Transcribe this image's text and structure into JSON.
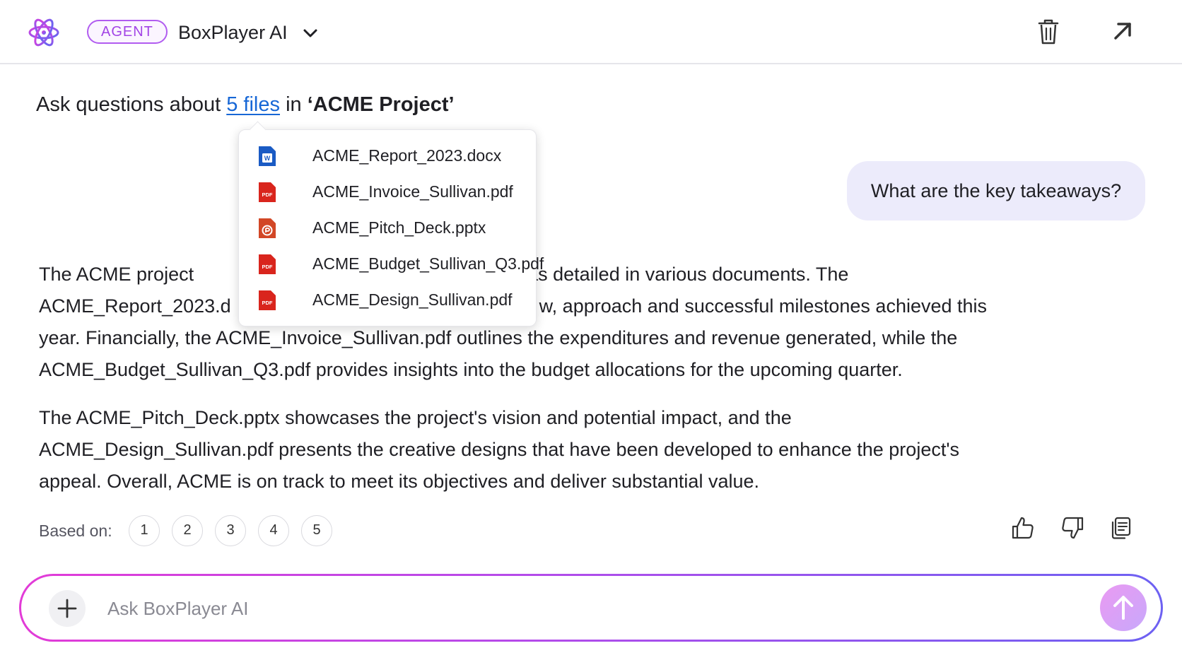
{
  "header": {
    "badge": "AGENT",
    "app_name": "BoxPlayer AI",
    "icons": {
      "logo": "atom-logo-icon",
      "dropdown": "chevron-down-icon",
      "delete": "trash-icon",
      "expand": "arrow-up-right-icon"
    }
  },
  "intro": {
    "prefix": "Ask questions about",
    "files_link": "5 files",
    "middle": "in",
    "project": "‘ACME Project’"
  },
  "files_popup": {
    "items": [
      {
        "name": "ACME_Report_2023.docx",
        "icon": "word-doc-icon"
      },
      {
        "name": "ACME_Invoice_Sullivan.pdf",
        "icon": "pdf-icon"
      },
      {
        "name": "ACME_Pitch_Deck.pptx",
        "icon": "powerpoint-icon"
      },
      {
        "name": "ACME_Budget_Sullivan_Q3.pdf",
        "icon": "pdf-icon"
      },
      {
        "name": "ACME_Design_Sullivan.pdf",
        "icon": "pdf-icon"
      }
    ],
    "pdf_badge": "PDF"
  },
  "user_message": "What are the key takeaways?",
  "answer": {
    "paragraph1_visible": "The ACME project ███████████████████████████3, as detailed in various documents. The ACME_Report_2023.d█████████████████████████████w, approach and successful milestones achieved this year. Financially, the ACME_Invoice_Sullivan.pdf outlines the expenditures and revenue generated, while the ACME_Budget_Sullivan_Q3.pdf provides insights into the budget allocations for the upcoming quarter.",
    "paragraph1_line1_start": "The ACME project",
    "paragraph1_line1_end": "3, as detailed in various documents. The",
    "paragraph1_line2_start": "ACME_Report_2023.d",
    "paragraph1_line2_end": "w, approach and successful milestones achieved this",
    "paragraph1_rest": "year. Financially, the ACME_Invoice_Sullivan.pdf outlines the expenditures and revenue generated, while the ACME_Budget_Sullivan_Q3.pdf provides insights into the budget allocations for the upcoming quarter.",
    "paragraph2": "The ACME_Pitch_Deck.pptx showcases the project's vision and potential impact, and the ACME_Design_Sullivan.pdf presents the creative designs that have been developed to enhance the project's appeal. Overall, ACME is on track to meet its objectives and deliver substantial value."
  },
  "sources": {
    "label": "Based on:",
    "items": [
      "1",
      "2",
      "3",
      "4",
      "5"
    ]
  },
  "feedback": {
    "icons": [
      "thumbs-up-icon",
      "thumbs-down-icon",
      "copy-icon"
    ]
  },
  "composer": {
    "placeholder": "Ask BoxPlayer AI",
    "value": "",
    "icons": {
      "add": "plus-icon",
      "send": "arrow-up-icon"
    }
  },
  "colors": {
    "accent_purple": "#a244e6",
    "link_blue": "#1767d6",
    "bubble_bg": "#ecebfb",
    "pdf_red": "#d9251d",
    "word_blue": "#1a5bc4",
    "ppt_orange": "#d24726",
    "gradient": [
      "#e23bd7",
      "#b44bea",
      "#6d61f2"
    ]
  }
}
